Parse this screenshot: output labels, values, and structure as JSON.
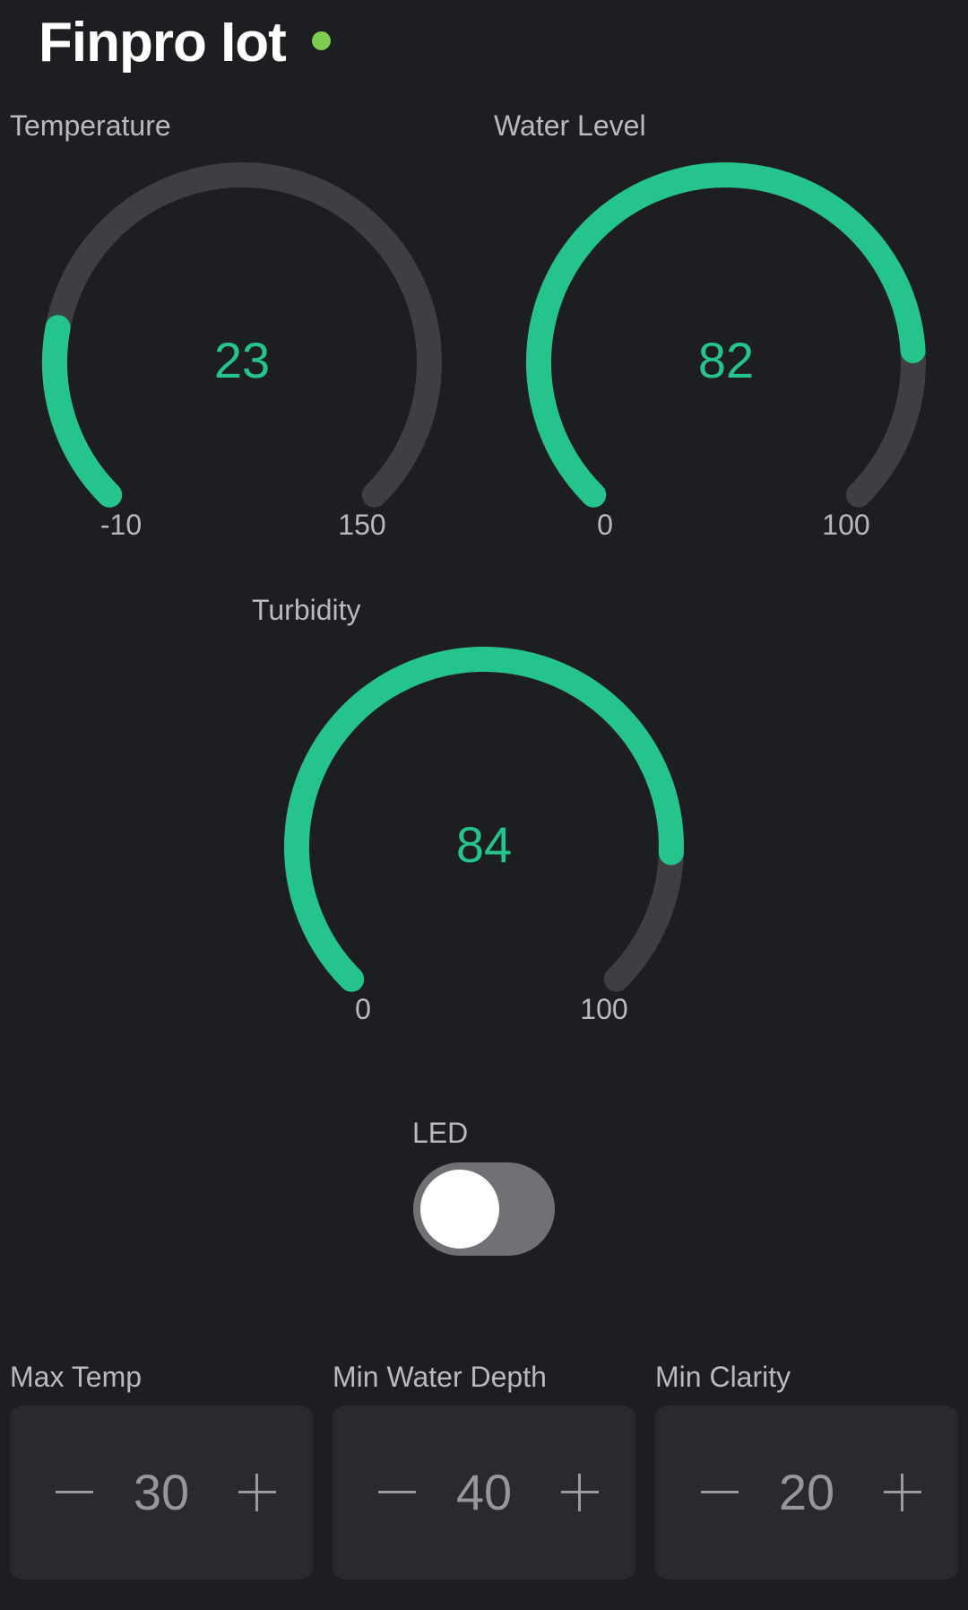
{
  "header": {
    "title": "Finpro Iot",
    "status_color": "#7ccc4d"
  },
  "gauges": [
    {
      "label": "Temperature",
      "value": 23,
      "min": -10,
      "max": 150
    },
    {
      "label": "Water Level",
      "value": 82,
      "min": 0,
      "max": 100
    },
    {
      "label": "Turbidity",
      "value": 84,
      "min": 0,
      "max": 100
    }
  ],
  "led": {
    "label": "LED",
    "state": "off"
  },
  "steppers": [
    {
      "label": "Max Temp",
      "value": "30"
    },
    {
      "label": "Min Water Depth",
      "value": "40"
    },
    {
      "label": "Min Clarity",
      "value": "20"
    }
  ],
  "colors": {
    "accent": "#25c48d",
    "track": "#3e3f43",
    "background": "#1d1e21"
  }
}
